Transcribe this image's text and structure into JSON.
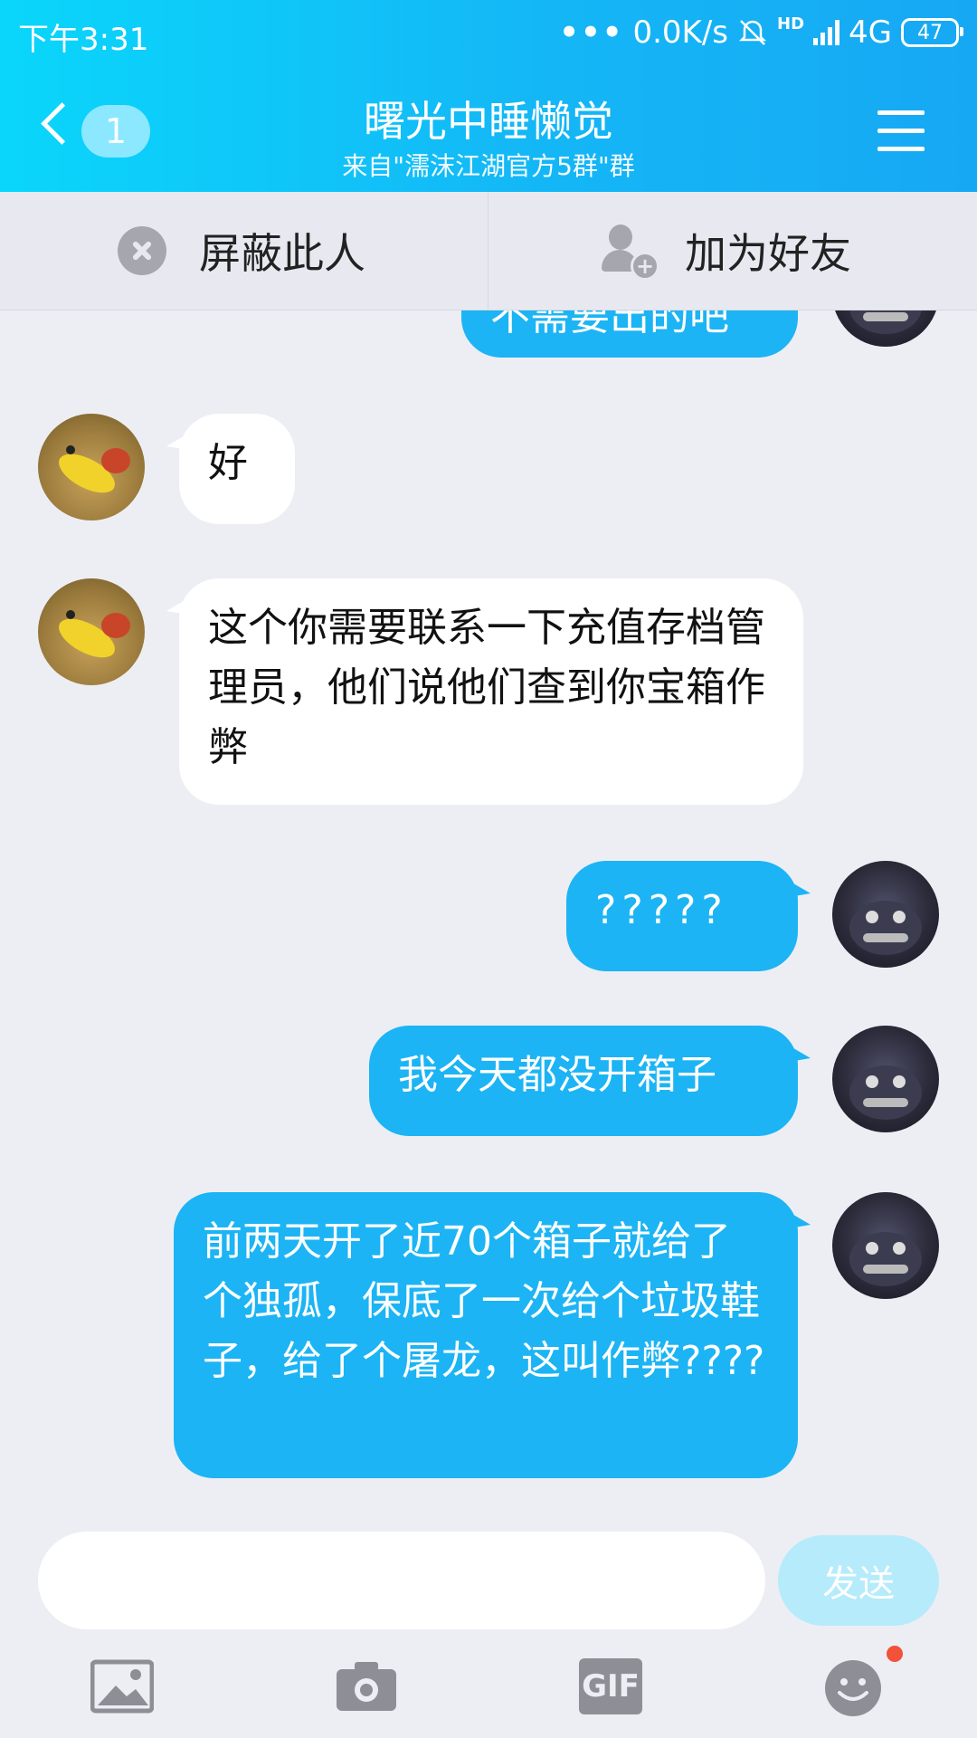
{
  "status_bar": {
    "time": "下午3:31",
    "network_speed": "0.0K/s",
    "hd": "HD",
    "network_type": "4G",
    "battery": "47"
  },
  "header": {
    "back_badge": "1",
    "title": "曙光中睡懒觉",
    "subtitle": "来自\"濡沫江湖官方5群\"群"
  },
  "actions": {
    "block_label": "屏蔽此人",
    "add_friend_label": "加为好友"
  },
  "messages": [
    {
      "side": "out",
      "text": "不需要出的吧"
    },
    {
      "side": "in",
      "text": "好"
    },
    {
      "side": "in",
      "text": "这个你需要联系一下充值存档管理员，他们说他们查到你宝箱作弊"
    },
    {
      "side": "out",
      "text": "?????"
    },
    {
      "side": "out",
      "text": "我今天都没开箱子"
    },
    {
      "side": "out",
      "text": "前两天开了近70个箱子就给了个独孤，保底了一次给个垃圾鞋子，给了个屠龙，这叫作弊????"
    }
  ],
  "input": {
    "placeholder": "",
    "send_label": "发送"
  },
  "toolbar": {
    "gif_label": "GIF"
  },
  "colors": {
    "header_gradient_start": "#0ad6fb",
    "header_gradient_end": "#17a8f4",
    "outgoing_bubble": "#1cb4f4",
    "incoming_bubble": "#ffffff",
    "send_button_disabled": "#b6ebfb",
    "notification_dot": "#f2513a"
  }
}
